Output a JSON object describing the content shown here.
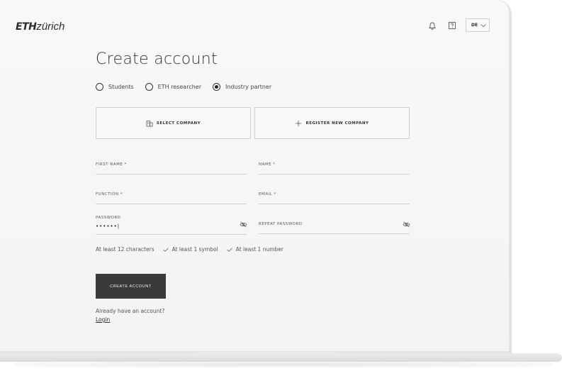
{
  "header": {
    "logo_bold": "ETH",
    "logo_rest": "zürich",
    "language": "DE"
  },
  "page": {
    "title": "Create account"
  },
  "account_type": {
    "options": [
      {
        "label": "Students",
        "selected": false
      },
      {
        "label": "ETH researcher",
        "selected": false
      },
      {
        "label": "Industry partner",
        "selected": true
      }
    ]
  },
  "company": {
    "select_label": "SELECT COMPANY",
    "register_label": "REGISTER NEW COMPANY"
  },
  "form": {
    "first_name_label": "FIRST NAME *",
    "name_label": "NAME *",
    "function_label": "FUNCTION *",
    "email_label": "EMAIL *",
    "password_label": "PASSWORD",
    "password_value": "••••••|",
    "repeat_password_label": "REPEAT PASSWORD"
  },
  "password_rules": {
    "length": "At least 12 characters",
    "symbol": "At least 1 symbol",
    "number": "At least 1 number"
  },
  "actions": {
    "create_label": "CREATE ACCOUNT",
    "already_text": "Already have an account?",
    "login_label": "Login"
  },
  "icons": {
    "bell": "bell-icon",
    "help": "help-icon",
    "chevron": "chevron-down-icon",
    "building": "building-icon",
    "plus": "plus-icon",
    "eye_off": "eye-off-icon",
    "check": "check-icon"
  }
}
